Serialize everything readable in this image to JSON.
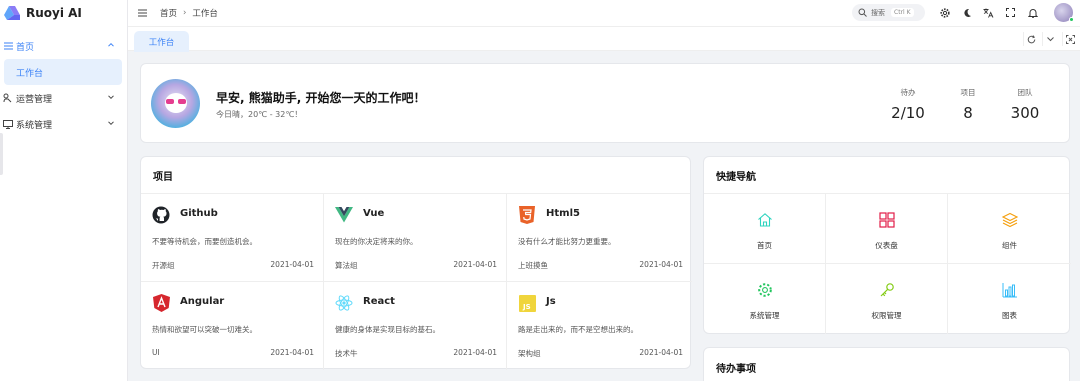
{
  "app": {
    "title": "Ruoyi AI"
  },
  "sidebar": {
    "items": [
      {
        "label": "首页",
        "expanded": true
      },
      {
        "label": "工作台",
        "active": true
      },
      {
        "label": "运营管理"
      },
      {
        "label": "系统管理"
      }
    ]
  },
  "header": {
    "breadcrumb": [
      "首页",
      "工作台"
    ],
    "search": {
      "label": "搜索",
      "shortcut": "Ctrl K"
    }
  },
  "tabs": [
    {
      "label": "工作台",
      "active": true
    }
  ],
  "welcome": {
    "greeting": "早安, 熊猫助手, 开始您一天的工作吧！",
    "weather": "今日晴，20℃ - 32℃！",
    "stats": [
      {
        "label": "待办",
        "value": "2/10"
      },
      {
        "label": "项目",
        "value": "8"
      },
      {
        "label": "团队",
        "value": "300"
      }
    ]
  },
  "projects": {
    "title": "项目",
    "items": [
      {
        "name": "Github",
        "icon": "github-icon",
        "desc": "不要等待机会，而要创造机会。",
        "group": "开源组",
        "date": "2021-04-01"
      },
      {
        "name": "Vue",
        "icon": "vue-icon",
        "desc": "现在的你决定将来的你。",
        "group": "算法组",
        "date": "2021-04-01"
      },
      {
        "name": "Html5",
        "icon": "html5-icon",
        "desc": "没有什么才能比努力更重要。",
        "group": "上班摸鱼",
        "date": "2021-04-01"
      },
      {
        "name": "Angular",
        "icon": "angular-icon",
        "desc": "热情和欲望可以突破一切难关。",
        "group": "UI",
        "date": "2021-04-01"
      },
      {
        "name": "React",
        "icon": "react-icon",
        "desc": "健康的身体是实现目标的基石。",
        "group": "技术牛",
        "date": "2021-04-01"
      },
      {
        "name": "Js",
        "icon": "js-icon",
        "desc": "路是走出来的，而不是空想出来的。",
        "group": "架构组",
        "date": "2021-04-01"
      }
    ]
  },
  "quick_nav": {
    "title": "快捷导航",
    "items": [
      {
        "label": "首页",
        "icon": "home-icon",
        "color": "#2dd4bf"
      },
      {
        "label": "仪表盘",
        "icon": "dashboard-icon",
        "color": "#e11d48"
      },
      {
        "label": "组件",
        "icon": "layers-icon",
        "color": "#f59e0b"
      },
      {
        "label": "系统管理",
        "icon": "gear-icon",
        "color": "#22c55e"
      },
      {
        "label": "权限管理",
        "icon": "key-icon",
        "color": "#84cc16"
      },
      {
        "label": "图表",
        "icon": "bar-chart-icon",
        "color": "#38bdf8"
      }
    ]
  },
  "todo": {
    "title": "待办事项"
  },
  "colors": {
    "accent": "#3b82f6",
    "tab_bg": "#e6f0fd"
  }
}
